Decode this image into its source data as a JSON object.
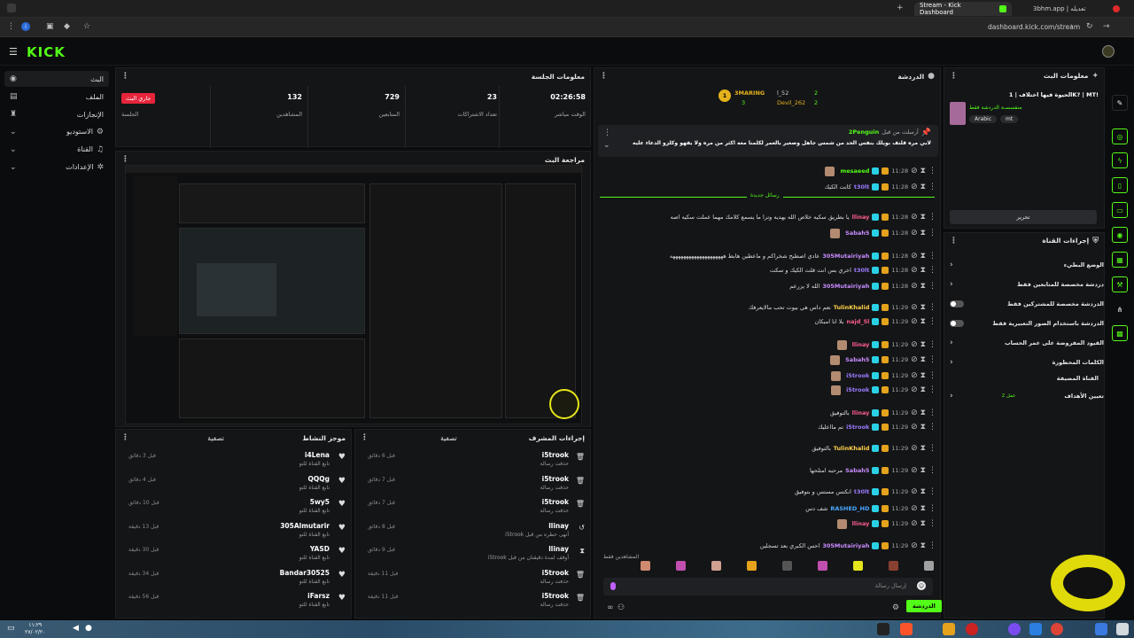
{
  "browser": {
    "tabs": [
      {
        "title": "Stream - Kick Dashboard"
      },
      {
        "title": "3bhm.app | تعديله"
      }
    ],
    "url": "dashboard.kick.com/stream"
  },
  "brand": {
    "logo": "KICK",
    "accent": "#53fc18"
  },
  "sidebar": {
    "items": [
      {
        "label": "البث",
        "icon": "broadcast-icon"
      },
      {
        "label": "الملف",
        "icon": "profile-icon"
      },
      {
        "label": "الإنجازات",
        "icon": "trophy-icon"
      },
      {
        "label": "الاستوديو",
        "icon": "studio-icon"
      },
      {
        "label": "القناة",
        "icon": "channel-icon"
      },
      {
        "label": "الإعدادات",
        "icon": "gear-icon"
      }
    ]
  },
  "session": {
    "title": "معلومات الجلسة",
    "live_badge": "جاري البث",
    "live_label": "الجلسة",
    "stats": [
      {
        "value": "132",
        "label": "المشاهدين"
      },
      {
        "value": "729",
        "label": "المتابعين"
      },
      {
        "value": "23",
        "label": "تعداد الاشتراكات"
      },
      {
        "value": "02:26:58",
        "label": "الوقت مباشر"
      }
    ]
  },
  "preview": {
    "title": "مراجعة البث"
  },
  "activity": {
    "title": "موجز النشاط",
    "filter": "تصفية",
    "rows": [
      {
        "name": "i4Lena",
        "sub": "تابع القناة للتو",
        "time": "قبل 3 دقائق"
      },
      {
        "name": "QQQg",
        "sub": "تابع القناة للتو",
        "time": "قبل 4 دقائق"
      },
      {
        "name": "5wy5",
        "sub": "تابع القناة للتو",
        "time": "قبل 10 دقائق"
      },
      {
        "name": "305Almutarir",
        "sub": "تابع القناة للتو",
        "time": "قبل 13 دقيقة"
      },
      {
        "name": "YASD",
        "sub": "تابع القناة للتو",
        "time": "قبل 30 دقيقة"
      },
      {
        "name": "Bandar30525",
        "sub": "تابع القناة للتو",
        "time": "قبل 34 دقيقة"
      },
      {
        "name": "iFarsz",
        "sub": "تابع القناة للتو",
        "time": "قبل 56 دقيقة"
      }
    ]
  },
  "modactions": {
    "title": "إجراءات المشرف",
    "filter": "تصفية",
    "rows": [
      {
        "name": "i5trook",
        "sub": "حذفت رسالة",
        "time": "قبل 6 دقائق",
        "icon": "trash-icon"
      },
      {
        "name": "i5trook",
        "sub": "حذفت رسالة",
        "time": "قبل 7 دقائق",
        "icon": "trash-icon"
      },
      {
        "name": "i5trook",
        "sub": "حذفت رسالة",
        "time": "قبل 7 دقائق",
        "icon": "trash-icon"
      },
      {
        "name": "llinay",
        "sub": "i5trook أنهى حظره من قبل",
        "time": "قبل 8 دقائق",
        "icon": "undo-icon"
      },
      {
        "name": "llinay",
        "sub": "i5trook أوقف لمدة دقيقتان من قبل",
        "time": "قبل 9 دقائق",
        "icon": "hourglass-icon"
      },
      {
        "name": "i5trook",
        "sub": "حذفت رسالة",
        "time": "قبل 11 دقيقة",
        "icon": "trash-icon"
      },
      {
        "name": "i5trook",
        "sub": "حذفت رسالة",
        "time": "قبل 11 دقيقة",
        "icon": "trash-icon"
      }
    ]
  },
  "chat": {
    "title": "الدردشة",
    "top": [
      {
        "name": "3MARING",
        "count": "3"
      },
      {
        "name": "l_52",
        "count": "2"
      },
      {
        "name": "Devil_262",
        "count": "2"
      }
    ],
    "pinned_by": "أرسلت من قبل",
    "pinned_user": "2Penguin",
    "pinned_text": "لابي مره قلنف بويلك بنفس الحد من شمس جاهل وصغير بالعمر لكلمنا معه اكثر من مره ولا يفهو وكلزو الدعاء عليه",
    "new_messages": "رسائل جديدة",
    "lines": [
      {
        "t": "11:28",
        "u": "mesaeed",
        "c": "#53fc18",
        "m": ""
      },
      {
        "t": "11:28",
        "u": "t30lt",
        "c": "#9b7bff",
        "m": "كانت الكيك"
      },
      {
        "t": "11:28",
        "u": "llinay",
        "c": "#ff5d8f",
        "m": "يا بطريق سكيه خلاص الله يهديه وترا ما يسمع كلامك مهما عملت سكيه اصه"
      },
      {
        "t": "11:28",
        "u": "Sabah5",
        "c": "#c88cff",
        "m": ""
      },
      {
        "t": "11:28",
        "u": "305Mutairiyah",
        "c": "#c88cff",
        "m": "عادي اصطبح شخراكم و ماعطين هابط ههههههههههههههههههههه"
      },
      {
        "t": "11:28",
        "u": "t30lt",
        "c": "#9b7bff",
        "m": "اخري بس انت قلت الكيك و سكت"
      },
      {
        "t": "11:28",
        "u": "305Mutairiyah",
        "c": "#c88cff",
        "m": "الله لا يزرعم"
      },
      {
        "t": "11:29",
        "u": "TulinKhalid",
        "c": "#ffd24a",
        "m": "نعم داس هي بيوت تحب مالايعرفك"
      },
      {
        "t": "11:29",
        "u": "najd_5l",
        "c": "#ff5d8f",
        "m": "بلا انا امبكان"
      },
      {
        "t": "11:29",
        "u": "llinay",
        "c": "#ff5d8f",
        "m": ""
      },
      {
        "t": "11:29",
        "u": "Sabah5",
        "c": "#c88cff",
        "m": ""
      },
      {
        "t": "11:29",
        "u": "i5trook",
        "c": "#9b7bff",
        "m": ""
      },
      {
        "t": "11:29",
        "u": "i5trook",
        "c": "#9b7bff",
        "m": ""
      },
      {
        "t": "11:29",
        "u": "llinay",
        "c": "#ff5d8f",
        "m": "بالتوفيق"
      },
      {
        "t": "11:29",
        "u": "i5trook",
        "c": "#9b7bff",
        "m": "تم مااعليك"
      },
      {
        "t": "11:29",
        "u": "TulinKhalid",
        "c": "#ffd24a",
        "m": "بالتوفيق"
      },
      {
        "t": "11:29",
        "u": "Sabah5",
        "c": "#c88cff",
        "m": "مرحبه امتلحها"
      },
      {
        "t": "11:29",
        "u": "t30lt",
        "c": "#9b7bff",
        "m": "انكتس مستس و بتوفيق"
      },
      {
        "t": "11:29",
        "u": "RASHED_HD",
        "c": "#4aa8ff",
        "m": "شف دس"
      },
      {
        "t": "11:29",
        "u": "llinay",
        "c": "#ff5d8f",
        "m": ""
      },
      {
        "t": "11:29",
        "u": "305Mutairiyah",
        "c": "#c88cff",
        "m": "احس الكبري بعد تسجلين"
      }
    ],
    "viewers_label": "المشاهدين فقط",
    "input_placeholder": "إرسال رسالة",
    "send_label": "الدردشة"
  },
  "streaminfo": {
    "title": "معلومات البث",
    "stream_title": "الحيوة فيها اختلاف | 1K? | MT!",
    "category": "منفسسـة الدردشة فقط",
    "tags": [
      "Arabic",
      "mt"
    ],
    "edit_label": "تحرير"
  },
  "channel_actions": {
    "title": "إجراءات القناة",
    "rows": [
      {
        "label": "الوضع البطيء",
        "type": "chevron"
      },
      {
        "label": "دردشة مخصصة للمتابعين فقط",
        "type": "chevron"
      },
      {
        "label": "الدردشة مخصصة للمشتركين فقط",
        "type": "toggle"
      },
      {
        "label": "الدردشة باستخدام الصور التعبيرية فقط",
        "type": "toggle"
      },
      {
        "label": "القيود المفروضة على عمر الحساب",
        "type": "chevron"
      },
      {
        "label": "الكلمات المحظورة",
        "type": "chevron"
      }
    ],
    "hosted_label": "القناة المضيفة",
    "hosted_value": "تعيين الأهداف",
    "hosted_status": "عمل 2"
  },
  "taskbar": {
    "date": "٢٧/٠٢/٢٠",
    "time": "١١:٢٩"
  }
}
